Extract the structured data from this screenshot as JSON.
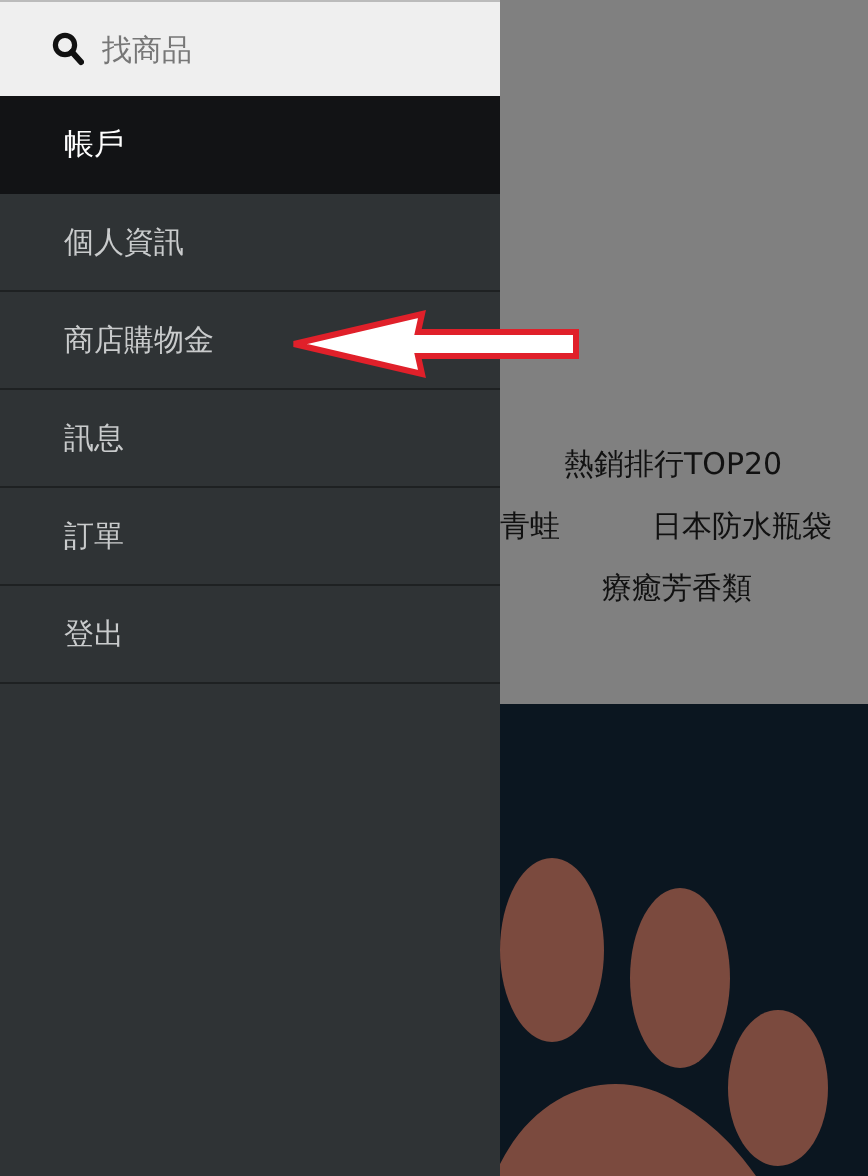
{
  "search": {
    "placeholder": "找商品"
  },
  "account_header": "帳戶",
  "menu": [
    {
      "label": "個人資訊"
    },
    {
      "label": "商店購物金"
    },
    {
      "label": "訊息"
    },
    {
      "label": "訂單"
    },
    {
      "label": "登出"
    }
  ],
  "category_links": [
    [
      "熱銷排行TOP20"
    ],
    [
      "青蛙",
      "日本防水瓶袋"
    ],
    [
      "療癒芳香類"
    ]
  ],
  "banner": {
    "kind": "picture"
  }
}
